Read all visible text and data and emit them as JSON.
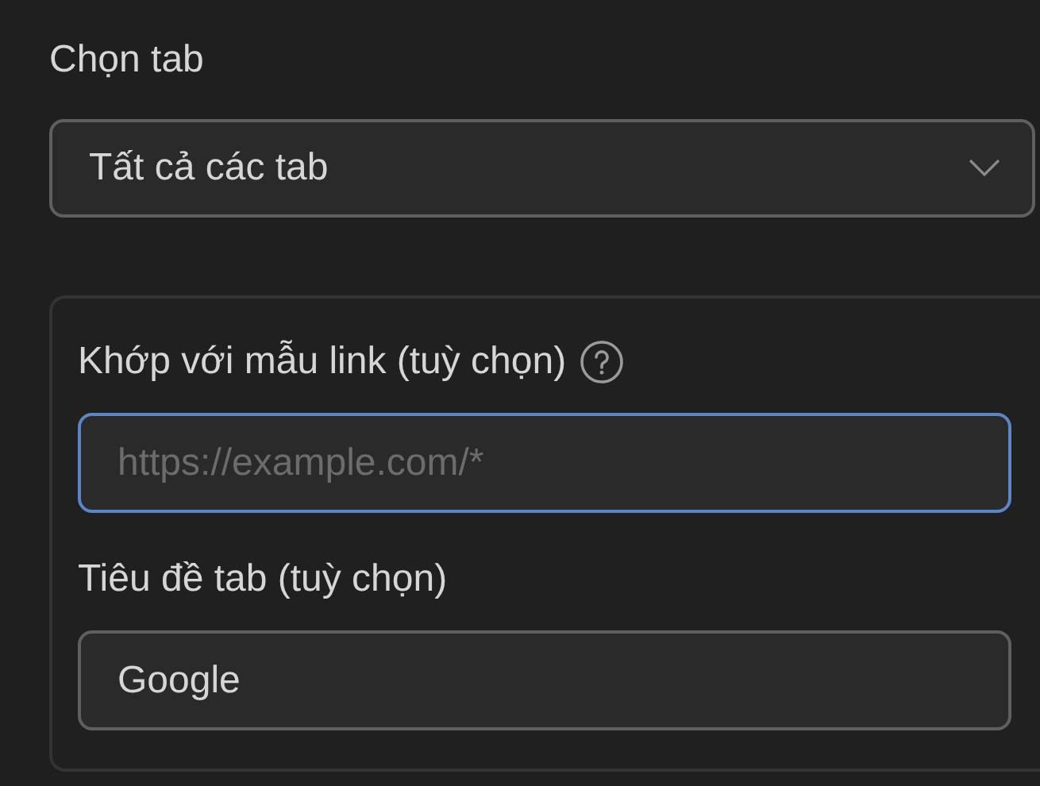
{
  "tab_select": {
    "label": "Chọn tab",
    "value": "Tất cả các tab"
  },
  "filters": [
    {
      "label": "Khớp với mẫu link (tuỳ chọn)",
      "has_help": true,
      "placeholder": "https://example.com/*",
      "focused": true
    },
    {
      "label": "Tiêu đề tab (tuỳ chọn)",
      "has_help": false,
      "value": "Google",
      "focused": false
    }
  ]
}
